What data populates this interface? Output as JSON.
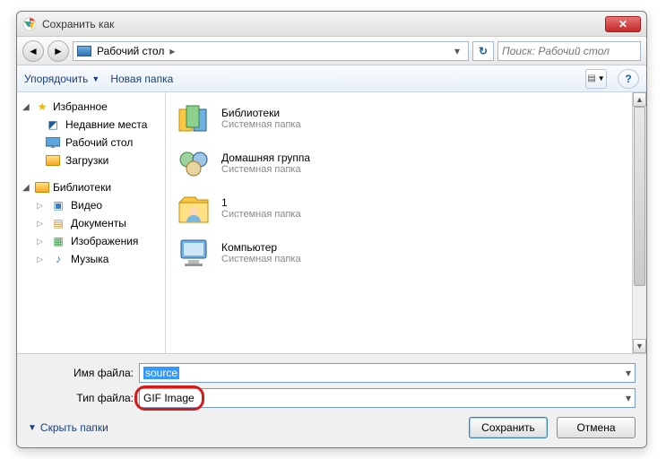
{
  "window": {
    "title": "Сохранить как"
  },
  "nav": {
    "location": "Рабочий стол",
    "breadcrumb_arrow": "▸",
    "search_placeholder": "Поиск: Рабочий стол"
  },
  "toolbar": {
    "organize": "Упорядочить",
    "newfolder": "Новая папка"
  },
  "sidebar": {
    "favorites": {
      "label": "Избранное",
      "items": [
        {
          "label": "Недавние места"
        },
        {
          "label": "Рабочий стол"
        },
        {
          "label": "Загрузки"
        }
      ]
    },
    "libraries": {
      "label": "Библиотеки",
      "items": [
        {
          "label": "Видео"
        },
        {
          "label": "Документы"
        },
        {
          "label": "Изображения"
        },
        {
          "label": "Музыка"
        }
      ]
    }
  },
  "content": {
    "subtype": "Системная папка",
    "items": [
      {
        "name": "Библиотеки"
      },
      {
        "name": "Домашняя группа"
      },
      {
        "name": "1"
      },
      {
        "name": "Компьютер"
      }
    ]
  },
  "footer": {
    "filename_label": "Имя файла:",
    "filename_value": "source",
    "filetype_label": "Тип файла:",
    "filetype_value": "GIF Image",
    "hide_folders": "Скрыть папки",
    "save": "Сохранить",
    "cancel": "Отмена"
  }
}
